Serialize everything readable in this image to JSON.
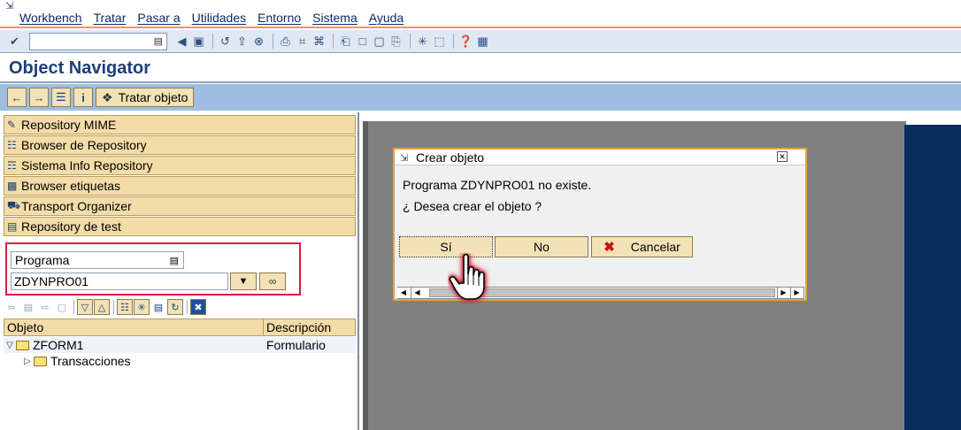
{
  "menu": {
    "items": [
      "Workbench",
      "Tratar",
      "Pasar a",
      "Utilidades",
      "Entorno",
      "Sistema",
      "Ayuda"
    ]
  },
  "toolbar": {
    "command_value": ""
  },
  "title": {
    "text": "Object Navigator"
  },
  "app_toolbar": {
    "edit_object_label": "Tratar objeto"
  },
  "nav": {
    "items": [
      {
        "label": "Repository MIME",
        "icon": "mime-icon"
      },
      {
        "label": "Browser de Repository",
        "icon": "tree-icon"
      },
      {
        "label": "Sistema Info Repository",
        "icon": "info-system-icon"
      },
      {
        "label": "Browser etiquetas",
        "icon": "tag-icon"
      },
      {
        "label": "Transport Organizer",
        "icon": "truck-icon"
      },
      {
        "label": "Repository de test",
        "icon": "test-icon"
      }
    ]
  },
  "selector": {
    "object_type": "Programa",
    "object_name": "ZDYNPRO01"
  },
  "tree": {
    "columns": [
      "Objeto",
      "Descripción"
    ],
    "rows": [
      {
        "name": "ZFORM1",
        "description": "Formulario",
        "expanded": true
      },
      {
        "name": "Transacciones",
        "description": "",
        "expanded": false
      }
    ]
  },
  "dialog": {
    "title": "Crear objeto",
    "message_line1": "Programa ZDYNPRO01 no existe.",
    "message_line2": "¿ Desea crear el objeto ?",
    "yes_label": "Sí",
    "no_label": "No",
    "cancel_label": "Cancelar"
  },
  "colors": {
    "accent_orange": "#e6a23c",
    "title_blue": "#1c3f78",
    "button_beige": "#f3e2b6",
    "highlight_red": "#e0193d",
    "side_blue": "#0a2f5c"
  }
}
